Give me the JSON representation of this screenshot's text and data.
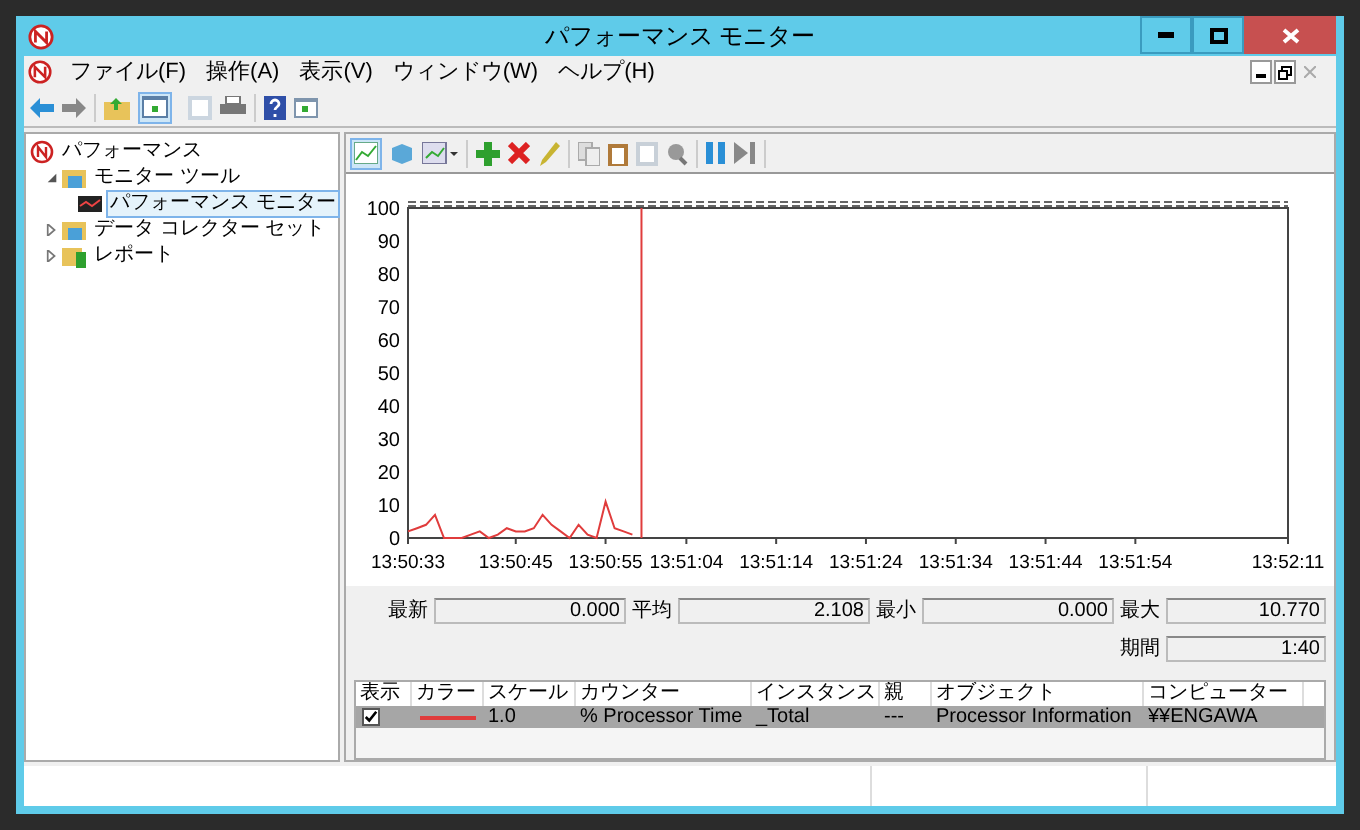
{
  "window": {
    "title": "パフォーマンス モニター"
  },
  "menu": [
    {
      "label": "ファイル(F)"
    },
    {
      "label": "操作(A)"
    },
    {
      "label": "表示(V)"
    },
    {
      "label": "ウィンドウ(W)"
    },
    {
      "label": "ヘルプ(H)"
    }
  ],
  "tree": [
    {
      "label": "パフォーマンス",
      "kind": "root",
      "selected": false,
      "children": [
        {
          "label": "モニター ツール",
          "kind": "folder",
          "selected": false,
          "expanded": true,
          "children": [
            {
              "label": "パフォーマンス モニター",
              "kind": "monitor",
              "selected": true
            }
          ]
        },
        {
          "label": "データ コレクター セット",
          "kind": "folder",
          "selected": false,
          "expanded": false
        },
        {
          "label": "レポート",
          "kind": "report",
          "selected": false,
          "expanded": false
        }
      ]
    }
  ],
  "chart": {
    "chart_data": {
      "type": "line",
      "categories": [
        "13:50:33",
        null,
        null,
        null,
        null,
        null,
        null,
        null,
        null,
        null,
        null,
        null,
        "13:50:45",
        null,
        null,
        null,
        null,
        null,
        null,
        null,
        null,
        null,
        "13:50:55",
        null,
        null,
        null,
        null,
        null,
        null,
        null,
        null,
        "13:51:04",
        null,
        null,
        null,
        null,
        null,
        null,
        null,
        null,
        null,
        "13:51:14",
        null,
        null,
        null,
        null,
        null,
        null,
        null,
        null,
        null,
        "13:51:24",
        null,
        null,
        null,
        null,
        null,
        null,
        null,
        null,
        null,
        "13:51:34",
        null,
        null,
        null,
        null,
        null,
        null,
        null,
        null,
        null,
        "13:51:44",
        null,
        null,
        null,
        null,
        null,
        null,
        null,
        null,
        null,
        "13:51:54",
        null,
        null,
        null,
        null,
        null,
        null,
        null,
        null,
        null,
        null,
        null,
        null,
        null,
        null,
        null,
        null,
        "13:52:11"
      ],
      "ylim": [
        0,
        100
      ],
      "yticks": [
        0,
        10,
        20,
        30,
        40,
        50,
        60,
        70,
        80,
        90,
        100
      ],
      "series": [
        {
          "color": "#e03c3c",
          "values": [
            2,
            3,
            4,
            7,
            0,
            0,
            0,
            1,
            2,
            0,
            1,
            3,
            2,
            2,
            3,
            7,
            4,
            2,
            0,
            4,
            1,
            0,
            11,
            3,
            2,
            1,
            null,
            null,
            null,
            null,
            null,
            null,
            null,
            null,
            null,
            null,
            null,
            null,
            null,
            null,
            null,
            null,
            null,
            null,
            null,
            null,
            null,
            null,
            null,
            null,
            null,
            null,
            null,
            null,
            null,
            null,
            null,
            null,
            null,
            null,
            null,
            null,
            null,
            null,
            null,
            null,
            null,
            null,
            null,
            null,
            null,
            null,
            null,
            null,
            null,
            null,
            null,
            null,
            null,
            null,
            null,
            null,
            null,
            null,
            null,
            null,
            null,
            null,
            null,
            null,
            null,
            null,
            null,
            null,
            null,
            null,
            null,
            null,
            null
          ]
        }
      ]
    }
  },
  "stats": [
    {
      "label": "最新",
      "value": "0.000"
    },
    {
      "label": "平均",
      "value": "2.108"
    },
    {
      "label": "最小",
      "value": "0.000"
    },
    {
      "label": "最大",
      "value": "10.770"
    },
    {
      "label": "期間",
      "value": "1:40"
    }
  ],
  "counters": {
    "columns": [
      "表示",
      "カラー",
      "スケール",
      "カウンター",
      "インスタンス",
      "親",
      "オブジェクト",
      "コンピューター"
    ],
    "rows": [
      {
        "checked": true,
        "color": "#e03c3c",
        "scale": "1.0",
        "counter": "% Processor Time",
        "instance": "_Total",
        "parent": "---",
        "object": "Processor Information",
        "computer": "¥¥ENGAWA",
        "selected": true
      }
    ]
  }
}
